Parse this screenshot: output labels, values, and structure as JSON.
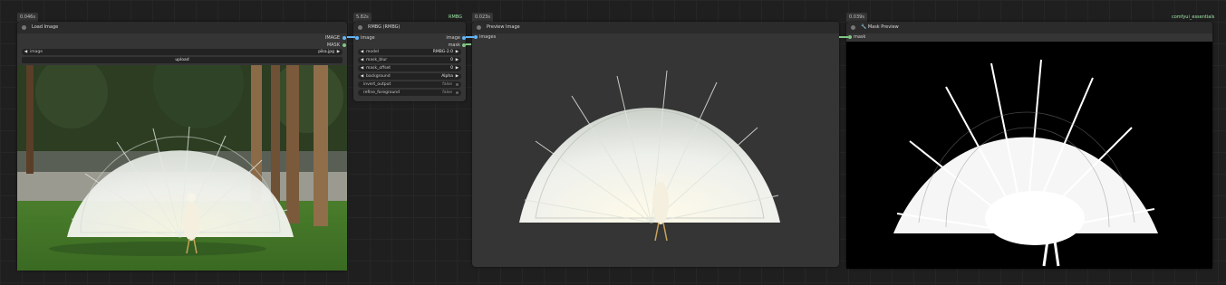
{
  "colors": {
    "image_wire": "#64b5f6",
    "mask_wire": "#81c784",
    "accent_text": "#9ee6a4"
  },
  "nodes": {
    "load_image": {
      "badge": "0.046s",
      "title": "Load Image",
      "outputs": [
        "IMAGE",
        "MASK"
      ],
      "image_widget": {
        "label": "image",
        "value": "pika.jpg"
      },
      "upload_label": "upload"
    },
    "rembg": {
      "badge": "5.82s",
      "badge_right": "RMBG",
      "title": "RMBG (RMBG)",
      "input": "image",
      "outputs": [
        "image",
        "mask"
      ],
      "widgets": [
        {
          "label": "model",
          "value": "RMBG-2.0"
        },
        {
          "label": "mask_blur",
          "value": "0"
        },
        {
          "label": "mask_offset",
          "value": "0"
        },
        {
          "label": "background",
          "value": "Alpha"
        },
        {
          "label": "invert_output",
          "value": "false"
        },
        {
          "label": "refine_foreground",
          "value": "false"
        }
      ]
    },
    "preview_image": {
      "badge": "0.023s",
      "title": "Preview Image",
      "input": "images"
    },
    "mask_preview": {
      "badge": "0.039s",
      "badge_right": "comfyui_essentials",
      "title": "🔧 Mask Preview",
      "input": "mask"
    }
  }
}
